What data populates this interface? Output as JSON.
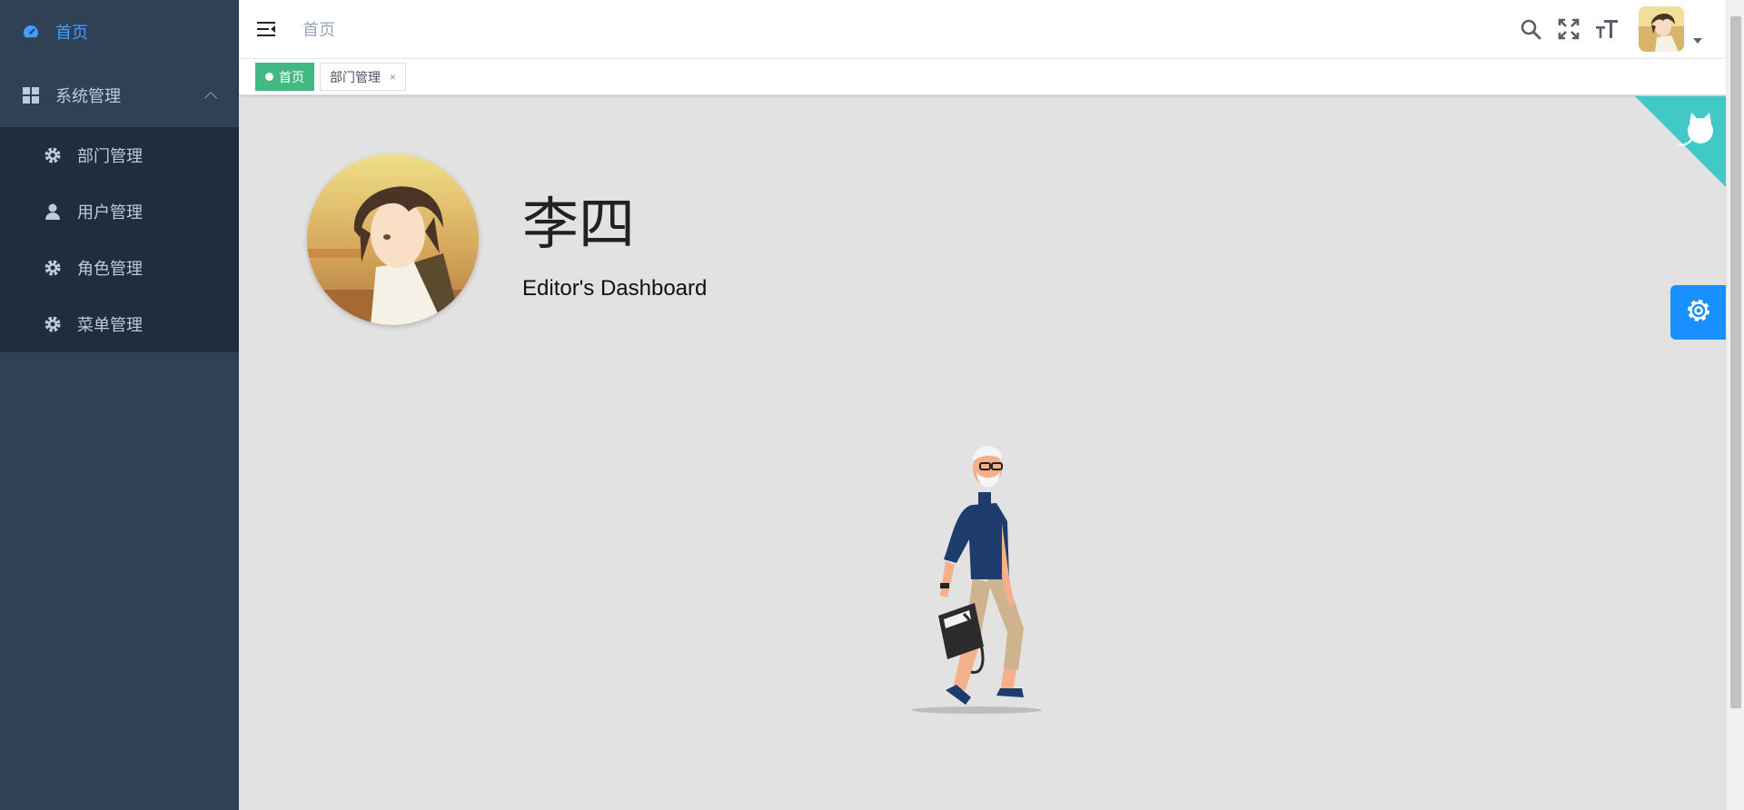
{
  "sidebar": {
    "items": [
      {
        "label": "首页",
        "icon": "dashboard-icon",
        "active": true
      },
      {
        "label": "系统管理",
        "icon": "grid-icon",
        "expanded": true
      }
    ],
    "submenu": [
      {
        "label": "部门管理",
        "icon": "gear-icon"
      },
      {
        "label": "用户管理",
        "icon": "user-icon"
      },
      {
        "label": "角色管理",
        "icon": "gear-icon"
      },
      {
        "label": "菜单管理",
        "icon": "gear-icon"
      }
    ]
  },
  "navbar": {
    "breadcrumb": "首页",
    "icons": [
      "search-icon",
      "fullscreen-icon",
      "font-size-icon"
    ]
  },
  "tags": [
    {
      "label": "首页",
      "active": true
    },
    {
      "label": "部门管理",
      "active": false,
      "close": "×"
    }
  ],
  "profile": {
    "name": "李四",
    "role": "Editor's Dashboard"
  },
  "colors": {
    "sidebar_bg": "#304156",
    "submenu_bg": "#1f2d3d",
    "active_menu": "#409eff",
    "active_tag": "#42b983",
    "settings_button": "#1890ff",
    "github_corner": "#40c9c6"
  }
}
